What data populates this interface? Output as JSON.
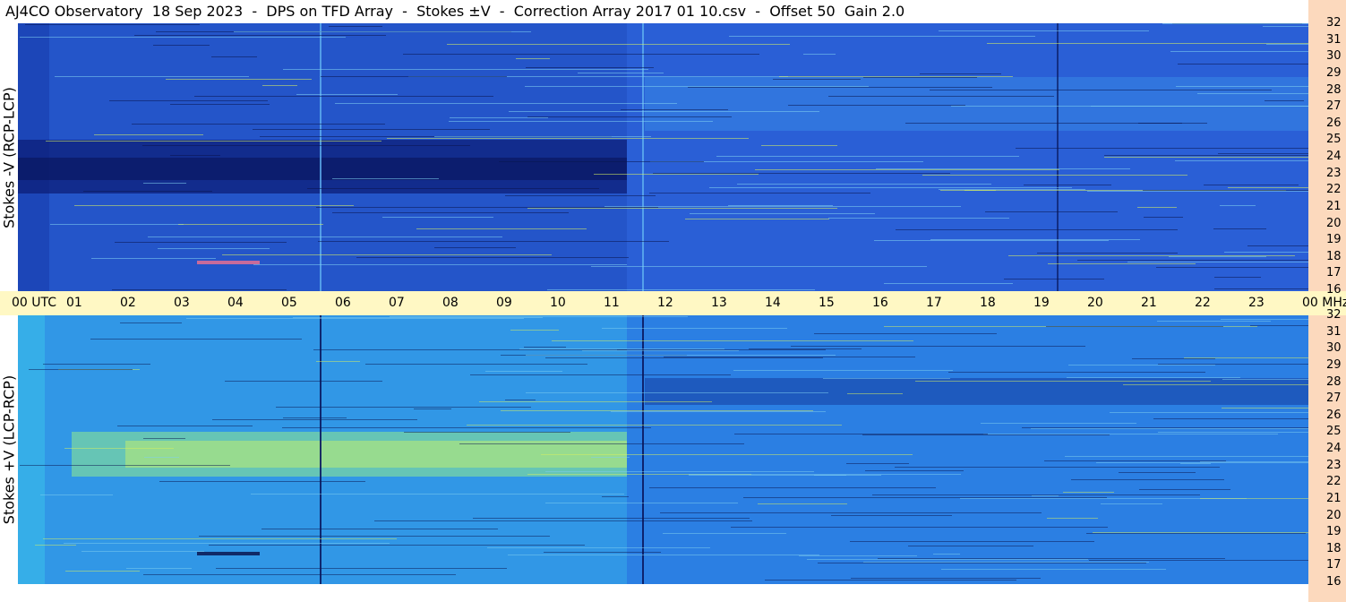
{
  "title": "AJ4CO Observatory  18 Sep 2023  -  DPS on TFD Array  -  Stokes ±V  -  Correction Array 2017 01 10.csv  -  Offset 50  Gain 2.0",
  "panels": {
    "top_label": "Stokes -V (RCP-LCP)",
    "bottom_label": "Stokes +V (LCP-RCP)"
  },
  "time_axis": {
    "labels": [
      "00 UTC",
      "01",
      "02",
      "03",
      "04",
      "05",
      "06",
      "07",
      "08",
      "09",
      "10",
      "11",
      "12",
      "13",
      "14",
      "15",
      "16",
      "17",
      "18",
      "19",
      "20",
      "21",
      "22",
      "23",
      "00 MHz"
    ]
  },
  "freq_axis": {
    "labels": [
      "32",
      "31",
      "30",
      "29",
      "28",
      "27",
      "26",
      "25",
      "24",
      "23",
      "22",
      "21",
      "20",
      "19",
      "18",
      "17",
      "16"
    ]
  },
  "colors": {
    "title_background": "#ffffff",
    "axis_band": "#fff8c4",
    "right_strip": "#fcd9bd",
    "top_base": "#2a5fd6",
    "top_dark": "#102a9a",
    "bottom_base": "#2b7fe3",
    "bottom_bright": "#8fe08a"
  },
  "chart_data": {
    "type": "heatmap",
    "title": "AJ4CO Observatory  18 Sep 2023  -  DPS on TFD Array  -  Stokes ±V  -  Correction Array 2017 01 10.csv  -  Offset 50  Gain 2.0",
    "x_axis": {
      "label": "UTC",
      "range": [
        0,
        24
      ],
      "unit": "hours"
    },
    "y_axis": {
      "label": "MHz",
      "range": [
        16,
        32
      ]
    },
    "series": [
      {
        "name": "Stokes -V (RCP-LCP)"
      },
      {
        "name": "Stokes +V (LCP-RCP)"
      }
    ],
    "grid": false,
    "legend": "none"
  }
}
